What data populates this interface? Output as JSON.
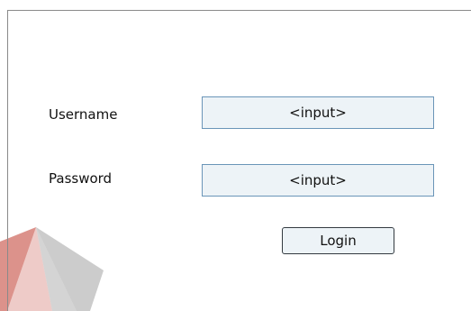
{
  "login_form": {
    "username_label": "Username",
    "username_value": "<input>",
    "password_label": "Password",
    "password_value": "<input>",
    "login_button_label": "Login"
  },
  "colors": {
    "field_background": "#edf3f7",
    "field_border": "#6a95b8",
    "button_border": "#333a40",
    "frame_border": "#8a8a8a",
    "watermark_red": "#c0392b",
    "watermark_gray": "#b0b0b0"
  },
  "icons": {
    "watermark": "logo-watermark-icon"
  }
}
